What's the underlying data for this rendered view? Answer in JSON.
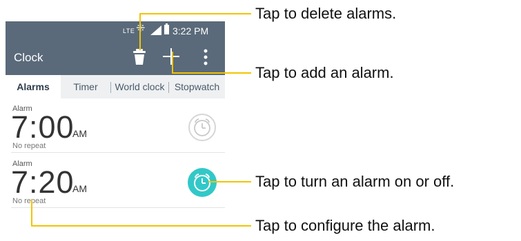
{
  "status_bar": {
    "network": "LTE",
    "time": "3:22 PM"
  },
  "app_bar": {
    "title": "Clock"
  },
  "tabs": [
    {
      "label": "Alarms",
      "active": true
    },
    {
      "label": "Timer",
      "active": false
    },
    {
      "label": "World clock",
      "active": false
    },
    {
      "label": "Stopwatch",
      "active": false
    }
  ],
  "alarms": [
    {
      "label": "Alarm",
      "time": "7:00",
      "ampm": "AM",
      "repeat": "No repeat",
      "enabled": false
    },
    {
      "label": "Alarm",
      "time": "7:20",
      "ampm": "AM",
      "repeat": "No repeat",
      "enabled": true
    }
  ],
  "callouts": {
    "delete": "Tap to delete alarms.",
    "add": "Tap to add an alarm.",
    "toggle": "Tap to turn an alarm on or off.",
    "configure": "Tap to configure the alarm."
  },
  "colors": {
    "app_bar": "#5a6a7a",
    "accent_on": "#32c8c8",
    "callout_line": "#f2c400"
  },
  "icons": [
    "trash-icon",
    "plus-icon",
    "overflow-menu-icon",
    "alarm-clock-icon",
    "signal-icon",
    "battery-icon",
    "sync-icon"
  ]
}
